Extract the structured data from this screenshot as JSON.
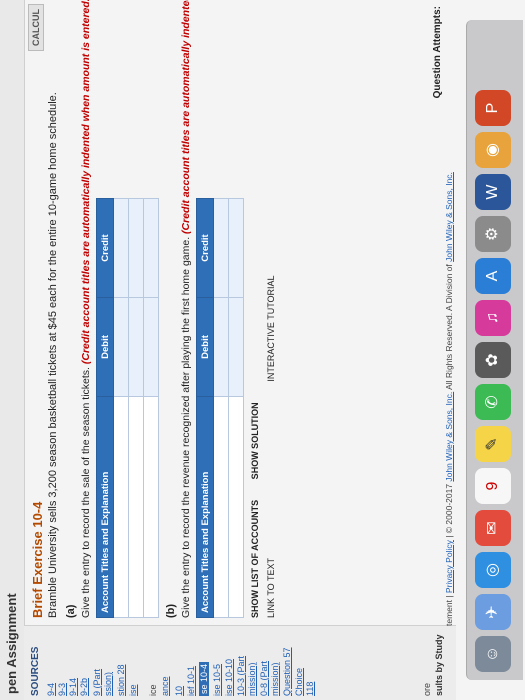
{
  "window": {
    "title": "pen Assignment",
    "calc_label": "CALCUL"
  },
  "sidebar": {
    "heading": "SOURCES",
    "items": [
      {
        "label": "9-4",
        "style": "link"
      },
      {
        "label": "9-3",
        "style": "link"
      },
      {
        "label": "9-14",
        "style": "link"
      },
      {
        "label": "9-2b",
        "style": "link"
      },
      {
        "label": "9 (Part",
        "style": "link"
      },
      {
        "label": "ssion)",
        "style": "link"
      },
      {
        "label": "stion 28",
        "style": "link"
      },
      {
        "label": "ise",
        "style": "link"
      },
      {
        "label": "ice",
        "style": "plain"
      },
      {
        "label": "ance",
        "style": "link"
      },
      {
        "label": "10",
        "style": "link"
      },
      {
        "label": "ief 10-1",
        "style": "link"
      },
      {
        "label": "se 10-4",
        "style": "active"
      },
      {
        "label": "ise 10-5",
        "style": "link"
      },
      {
        "label": "ise 10-10",
        "style": "link"
      },
      {
        "label": "10-3 (Part",
        "style": "link"
      },
      {
        "label": "mission)",
        "style": "link"
      },
      {
        "label": "0-8 (Part",
        "style": "link"
      },
      {
        "label": "mission)",
        "style": "link"
      },
      {
        "label": "Question 57",
        "style": "link"
      },
      {
        "label": "Choice",
        "style": "link"
      },
      {
        "label": "118",
        "style": "link"
      }
    ],
    "study_a": "ore",
    "study_b": "sults by Study"
  },
  "exercise": {
    "title": "Brief Exercise 10-4",
    "text": "Bramble University sells 3,200 season basketball tickets at $45 each for the entire 10-game home schedule.",
    "part_a": {
      "label": "(a)",
      "instruction": "Give the entry to record the sale of the season tickets.",
      "note": "(Credit account titles are automatically indented when amount is entered. Do"
    },
    "part_b": {
      "label": "(b)",
      "instruction": "Give the entry to record the revenue recognized after playing the first home game.",
      "note": "(Credit account titles are automatically indented whe"
    },
    "table": {
      "col_account": "Account Titles and Explanation",
      "col_debit": "Debit",
      "col_credit": "Credit"
    },
    "show_accounts": "SHOW LIST OF ACCOUNTS",
    "show_solution": "SHOW SOLUTION",
    "link_text": "LINK TO TEXT",
    "interactive_tutorial": "INTERACTIVE TUTORIAL"
  },
  "footer": {
    "prefix": "tement",
    "privacy": "Privacy Policy",
    "copyright": "© 2000-2017",
    "company": "John Wiley & Sons, Inc.",
    "rights": "All Rights Reserved. A Division of",
    "company2": "John Wiley & Sons, Inc.",
    "question_attempts": "Question Attempts:"
  },
  "dock": {
    "calendar_day": "9"
  }
}
